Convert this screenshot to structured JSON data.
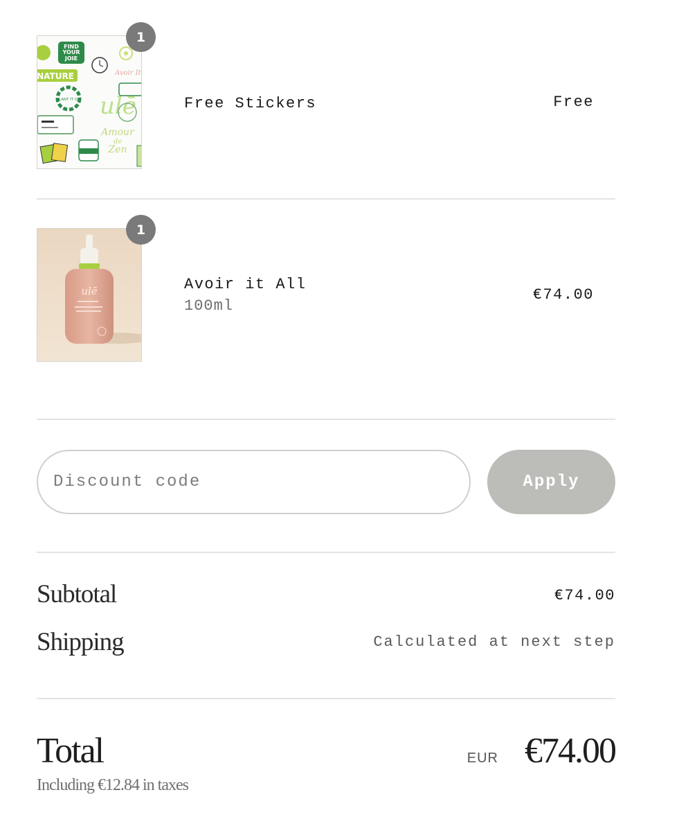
{
  "items": [
    {
      "name": "Free Stickers",
      "variant": "",
      "price": "Free",
      "quantity": "1",
      "image": "stickers-sheet"
    },
    {
      "name": "Avoir it All",
      "variant": "100ml",
      "price": "€74.00",
      "quantity": "1",
      "image": "serum-bottle"
    }
  ],
  "discount": {
    "placeholder": "Discount code",
    "value": "",
    "apply_label": "Apply"
  },
  "summary": {
    "subtotal_label": "Subtotal",
    "subtotal_value": "€74.00",
    "shipping_label": "Shipping",
    "shipping_value": "Calculated at next step"
  },
  "total": {
    "label": "Total",
    "taxes_note": "Including €12.84 in taxes",
    "currency": "EUR",
    "amount": "€74.00"
  },
  "sticker_sheet_text": [
    "FIND YOUR JOIE",
    "NATURE",
    "Avoir It",
    "PLANT IT ON",
    "ulē",
    "Amour de Zen"
  ],
  "bottle_text": "ulē",
  "colors": {
    "badge": "#7a7a7a",
    "apply_button": "#bcbcb8",
    "divider": "#e4e4e4",
    "sticker_green": "#2f8a4a",
    "lime": "#a8cf3f",
    "bottle": "#e0a893"
  }
}
